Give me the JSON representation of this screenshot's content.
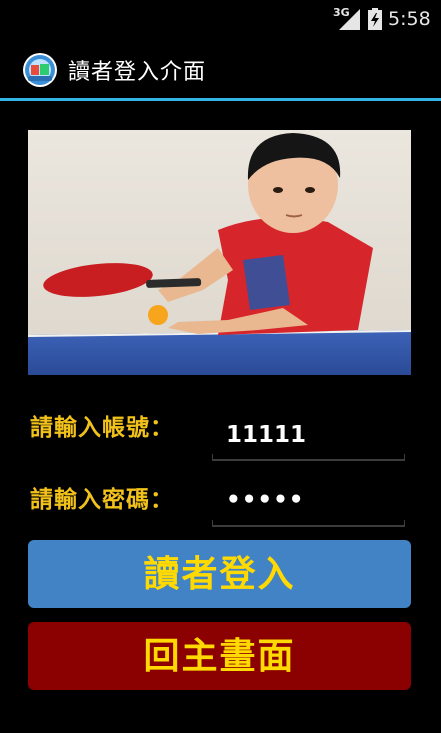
{
  "status_bar": {
    "network_label": "3G",
    "time": "5:58"
  },
  "action_bar": {
    "title": "讀者登入介面",
    "icon": "app-logo-icon",
    "divider_color": "#33b5e5"
  },
  "photo": {
    "subject": "child-holding-table-tennis-paddle"
  },
  "form": {
    "account_label": "請輸入帳號：",
    "account_value": "11111",
    "password_label": "請輸入密碼：",
    "password_value": "11111"
  },
  "buttons": {
    "login_label": "讀者登入",
    "home_label": "回主畫面"
  },
  "colors": {
    "label_color": "#f2c21b",
    "login_button": "#4183c4",
    "home_button": "#8b0000",
    "button_text": "#ffd900"
  }
}
